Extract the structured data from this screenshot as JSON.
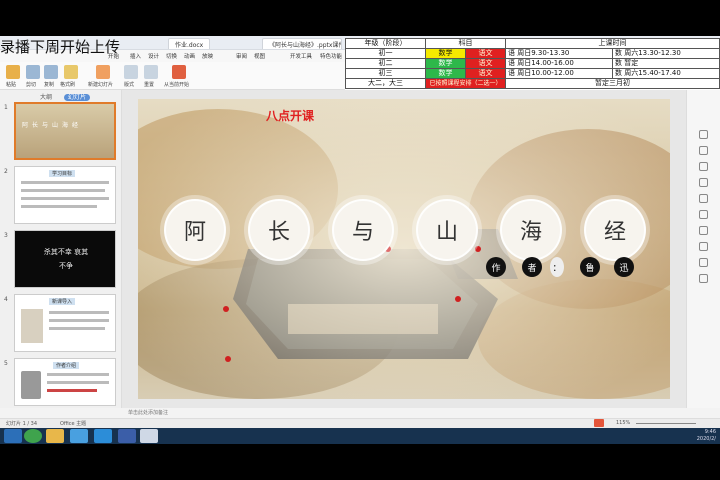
{
  "overlay": {
    "banner": "录播下周开始上传"
  },
  "titlebar": {
    "tabs": [
      "作业.docx",
      "《阿长与山海经》.pptx课件 - 16.pptx"
    ]
  },
  "menubar": {
    "items": [
      "开始",
      "插入",
      "设计",
      "切换",
      "动画",
      "放映",
      "审阅",
      "视图",
      "开发工具",
      "特色功能"
    ]
  },
  "toolbar": {
    "buttons": [
      "粘贴",
      "剪切",
      "复制",
      "格式刷",
      "新建幻灯片",
      "版式",
      "重置",
      "从当前开始"
    ]
  },
  "schedule": {
    "headers": [
      "年级（阶段）",
      "科目",
      "上课时间"
    ],
    "rows": [
      {
        "grade": "初一",
        "s1": "数学",
        "s2": "语文",
        "t1": "语 周日9.30-13.30",
        "t2": "数 周六13.30-12.30"
      },
      {
        "grade": "初二",
        "s1": "数学",
        "s2": "语文",
        "t1": "语 周日14.00-16.00",
        "t2": "数 暂定"
      },
      {
        "grade": "初三",
        "s1": "数学",
        "s2": "语文",
        "t1": "语 周日10.00-12.00",
        "t2": "数 周六15.40-17.40"
      },
      {
        "grade": "大二，大三",
        "s1": "已按照课程安排（二选一）",
        "s2": "",
        "t1": "暂定三月初",
        "t2": ""
      }
    ]
  },
  "leftpanel": {
    "tabs": [
      "大纲",
      "幻灯片"
    ],
    "thumbs": [
      {
        "num": "1",
        "text": "阿长与山海经"
      },
      {
        "num": "2",
        "text": "学习目标"
      },
      {
        "num": "3",
        "text": "杀其不幸 哀其不争"
      },
      {
        "num": "4",
        "text": "新课导入"
      },
      {
        "num": "5",
        "text": "作者介绍"
      }
    ]
  },
  "slide": {
    "notice": "八点开课",
    "title_chars": [
      "阿",
      "长",
      "与",
      "山",
      "海",
      "经"
    ],
    "author_chars": [
      "作",
      "者",
      "：",
      "鲁",
      "迅"
    ]
  },
  "notes": {
    "placeholder": "单击此处添加备注"
  },
  "statusbar": {
    "left": "幻灯片 1 / 34",
    "theme": "Office 主题",
    "zoom": "115%"
  },
  "taskbar": {
    "time": "9:46",
    "date": "2020/2/"
  }
}
